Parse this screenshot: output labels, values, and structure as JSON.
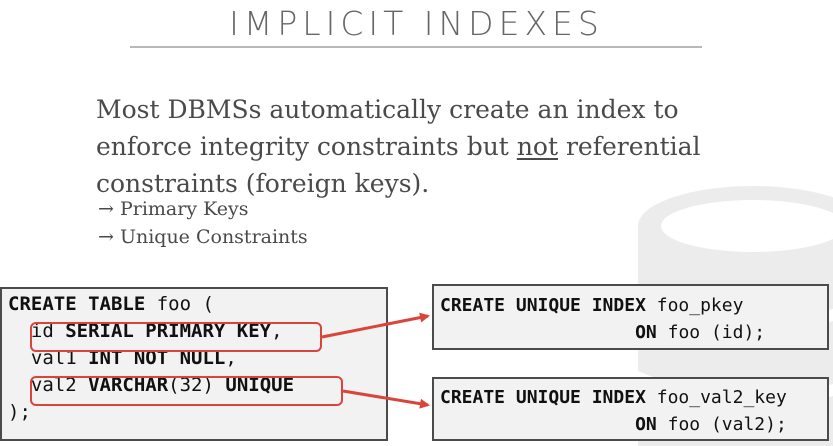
{
  "slide": {
    "title": "IMPLICIT INDEXES",
    "paragraph_before": "Most DBMSs automatically create an index to enforce integrity constraints but ",
    "paragraph_underlined": "not",
    "paragraph_after": " referential constraints (foreign keys).",
    "bullets": [
      "→ Primary Keys",
      "→ Unique Constraints"
    ]
  },
  "code": {
    "create_table": {
      "line1_kw": "CREATE TABLE",
      "line1_rest": " foo (",
      "line2_indent": "  ",
      "line2_id": "id ",
      "line2_kw": "SERIAL PRIMARY KEY",
      "line2_end": ",",
      "line3_indent": "  ",
      "line3_name": "val1 ",
      "line3_kw": "INT NOT NULL",
      "line3_end": ",",
      "line4_indent": "  ",
      "line4_name": "val2 ",
      "line4_kw1": "VARCHAR",
      "line4_arg": "(32) ",
      "line4_kw2": "UNIQUE",
      "line5": ");"
    },
    "pkey_index": {
      "line1_kw": "CREATE UNIQUE INDEX",
      "line1_rest": " foo_pkey",
      "line2_indent": "                  ",
      "line2_kw": "ON",
      "line2_rest": " foo (id);"
    },
    "val2_index": {
      "line1_kw": "CREATE UNIQUE INDEX",
      "line1_rest": " foo_val2_key",
      "line2_indent": "                  ",
      "line2_kw": "ON",
      "line2_rest": " foo (val2);"
    }
  },
  "colors": {
    "highlight": "#d9443b",
    "code_background": "#f2f2f2",
    "title_rule": "#b8b8b8"
  }
}
